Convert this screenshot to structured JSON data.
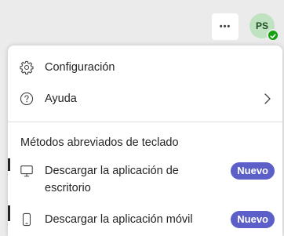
{
  "topbar": {
    "more_label": "•••",
    "avatar_initials": "PS",
    "presence_status": "available",
    "presence_color": "#13a10e"
  },
  "menu": {
    "items": [
      {
        "label": "Configuración",
        "icon": "gear-icon"
      },
      {
        "label": "Ayuda",
        "icon": "help-circle-icon",
        "submenu": true
      }
    ],
    "shortcuts_title": "Métodos abreviados de teclado",
    "downloads": [
      {
        "label_line1": "Descargar la aplicación de",
        "label_line2": "escritorio",
        "badge": "Nuevo",
        "icon": "desktop-icon"
      },
      {
        "label": "Descargar la aplicación móvil",
        "badge": "Nuevo",
        "icon": "mobile-phone-icon"
      }
    ]
  },
  "colors": {
    "badge": "#5b5fc7",
    "avatar_bg": "#bfe3c0"
  }
}
